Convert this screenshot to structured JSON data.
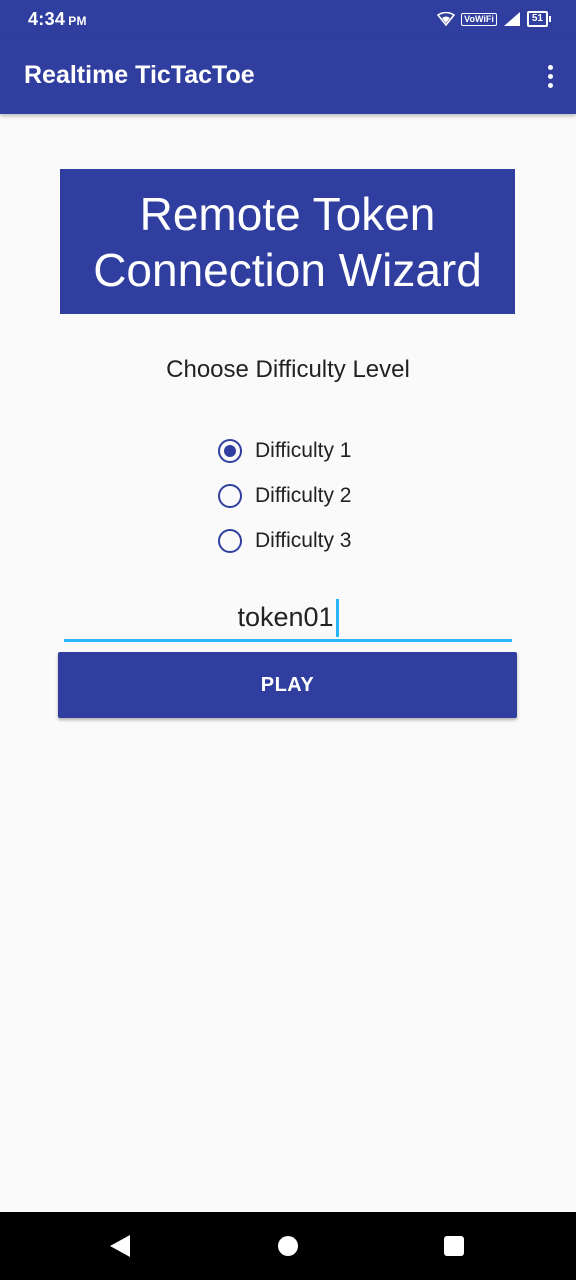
{
  "status_bar": {
    "time": "4:34",
    "ampm": "PM",
    "network_badge": "VoWiFi",
    "battery": "51"
  },
  "app_bar": {
    "title": "Realtime TicTacToe",
    "overflow_icon": "more-vert-icon"
  },
  "banner": {
    "title": "Remote Token Connection Wizard"
  },
  "difficulty": {
    "label": "Choose Difficulty Level",
    "selected_index": 0,
    "options": [
      {
        "label": "Difficulty 1",
        "checked": true
      },
      {
        "label": "Difficulty 2",
        "checked": false
      },
      {
        "label": "Difficulty 3",
        "checked": false
      }
    ]
  },
  "token_input": {
    "value": "token01"
  },
  "play_button": {
    "label": "PLAY"
  },
  "nav_bar": {
    "back_icon": "back-triangle-icon",
    "home_icon": "home-circle-icon",
    "recent_icon": "recents-square-icon"
  },
  "colors": {
    "primary": "#303f9f",
    "accent": "#29b6f6",
    "background": "#fafafa"
  }
}
